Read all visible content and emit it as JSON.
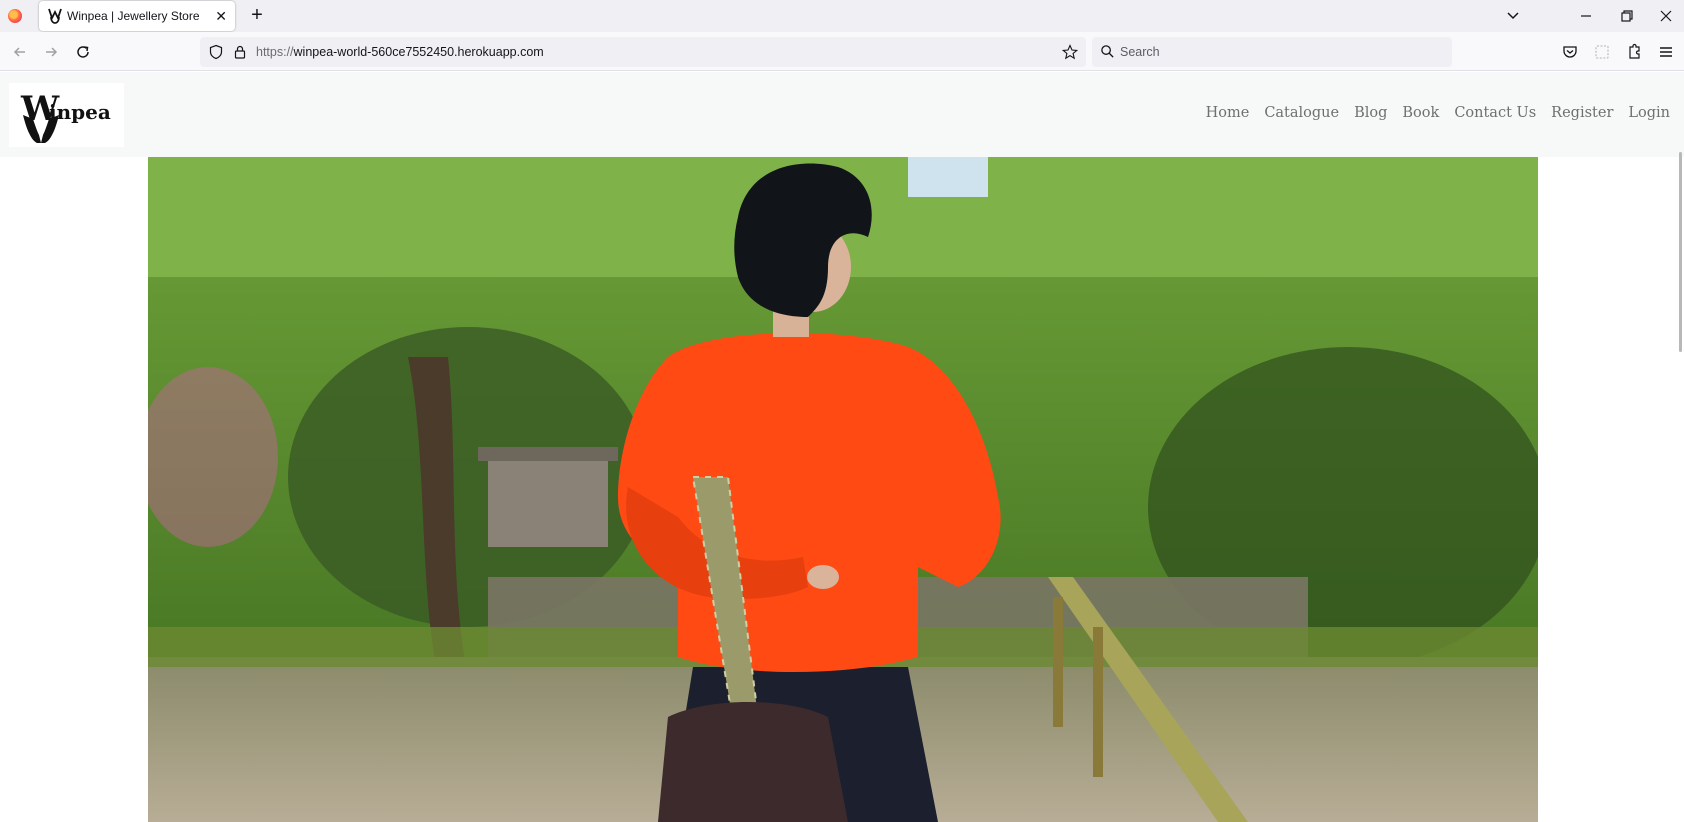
{
  "browser": {
    "tab": {
      "title": "Winpea | Jewellery Store"
    },
    "url": {
      "host": "winpea-world-560ce7552450.herokuapp.com",
      "scheme": "https://"
    },
    "search": {
      "placeholder": "Search"
    }
  },
  "site": {
    "logo": {
      "initial": "W",
      "rest": "inpea"
    },
    "nav": [
      {
        "label": "Home"
      },
      {
        "label": "Catalogue"
      },
      {
        "label": "Blog"
      },
      {
        "label": "Book"
      },
      {
        "label": "Contact Us"
      },
      {
        "label": "Register"
      },
      {
        "label": "Login"
      }
    ]
  },
  "colors": {
    "sweater": "#ff4a14",
    "foliage": "#5a8a2c",
    "nav_text": "#6f6f6f"
  }
}
